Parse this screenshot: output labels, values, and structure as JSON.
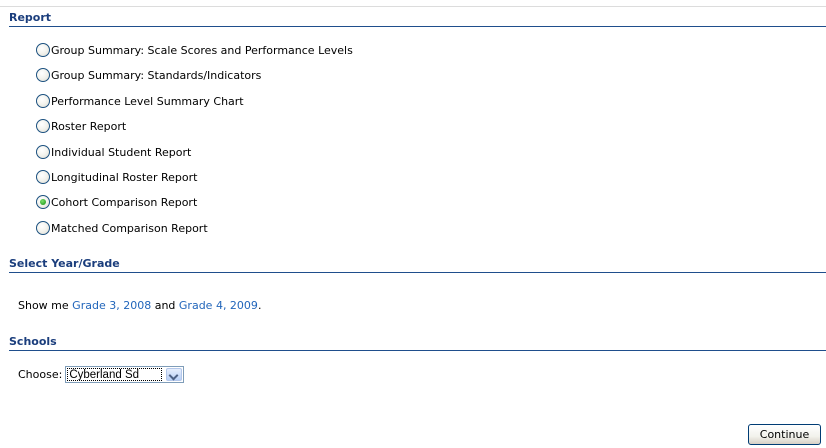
{
  "report": {
    "header": "Report",
    "options": [
      {
        "label": "Group Summary: Scale Scores and Performance Levels",
        "checked": false
      },
      {
        "label": "Group Summary: Standards/Indicators",
        "checked": false
      },
      {
        "label": "Performance Level Summary Chart",
        "checked": false
      },
      {
        "label": "Roster Report",
        "checked": false
      },
      {
        "label": "Individual Student Report",
        "checked": false
      },
      {
        "label": "Longitudinal Roster Report",
        "checked": false
      },
      {
        "label": "Cohort Comparison Report",
        "checked": true
      },
      {
        "label": "Matched Comparison Report",
        "checked": false
      }
    ]
  },
  "year_grade": {
    "header": "Select Year/Grade",
    "prefix": "Show me ",
    "link1": "Grade 3, 2008",
    "middle": " and ",
    "link2": "Grade 4, 2009",
    "suffix": "."
  },
  "schools": {
    "header": "Schools",
    "choose_label": "Choose:",
    "selected": "Cyberland Sd"
  },
  "actions": {
    "continue_label": "Continue"
  },
  "colors": {
    "header_text": "#1a3d7c",
    "header_rule": "#1f4e8c",
    "link": "#2266bb",
    "radio_checked": "#2fa62a"
  }
}
